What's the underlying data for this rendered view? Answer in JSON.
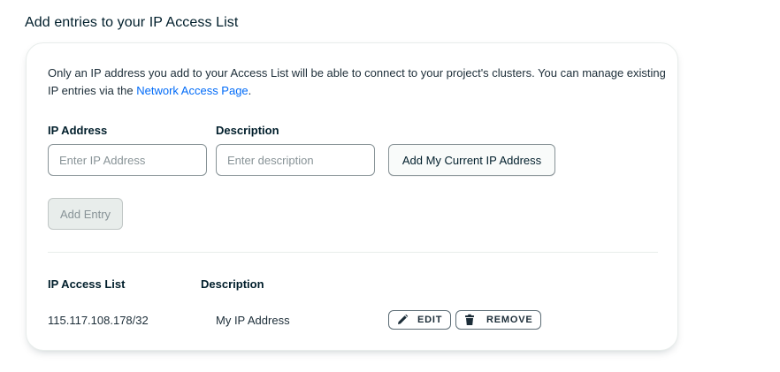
{
  "section_title": "Add entries to your IP Access List",
  "intro": {
    "text_before_link": "Only an IP address you add to your Access List will be able to connect to your project's clusters. You can manage existing IP entries via the ",
    "link_text": "Network Access Page",
    "text_after_link": "."
  },
  "form": {
    "ip_label": "IP Address",
    "ip_placeholder": "Enter IP Address",
    "ip_value": "",
    "description_label": "Description",
    "description_placeholder": "Enter description",
    "description_value": "",
    "add_current_ip_button": "Add My Current IP Address",
    "add_entry_button": "Add Entry"
  },
  "access_list": {
    "headers": {
      "ip": "IP Access List",
      "description": "Description"
    },
    "rows": [
      {
        "ip": "115.117.108.178/32",
        "description": "My IP Address",
        "edit_label": "EDIT",
        "remove_label": "REMOVE"
      }
    ]
  },
  "icons": {
    "edit": "pencil-icon",
    "remove": "trash-icon"
  },
  "colors": {
    "link": "#016bf8",
    "text": "#1c2d38",
    "disabled_bg": "#e8edeb"
  }
}
